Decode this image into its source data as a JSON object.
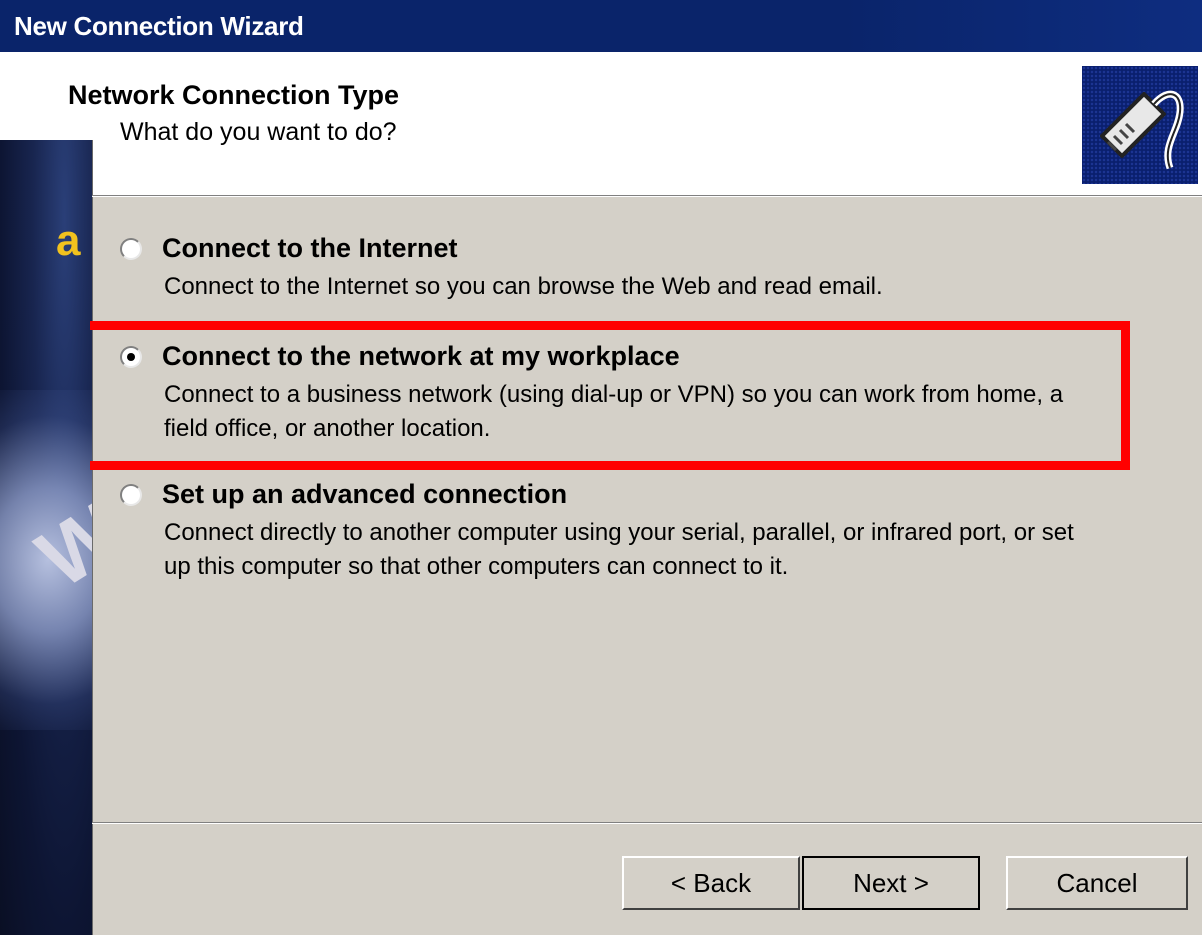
{
  "window": {
    "title": "New Connection Wizard"
  },
  "header": {
    "title": "Network Connection Type",
    "subtitle": "What do you want to do?",
    "icon": "network-cable-icon"
  },
  "options": [
    {
      "label": "Connect to the Internet",
      "description": "Connect to the Internet so you can browse the Web and read email.",
      "selected": false
    },
    {
      "label": "Connect to the network at my workplace",
      "description": "Connect to a business network (using dial-up or VPN) so you can work from home, a field office, or another location.",
      "selected": true
    },
    {
      "label": "Set up an advanced connection",
      "description": "Connect directly to another computer using your serial, parallel, or infrared port, or set up this computer so that other computers can connect to it.",
      "selected": false
    }
  ],
  "buttons": {
    "back": "< Back",
    "next": "Next >",
    "cancel": "Cancel"
  },
  "colors": {
    "titlebar": "#0a246a",
    "dialog": "#d4d0c8",
    "highlight": "#ff0000"
  }
}
